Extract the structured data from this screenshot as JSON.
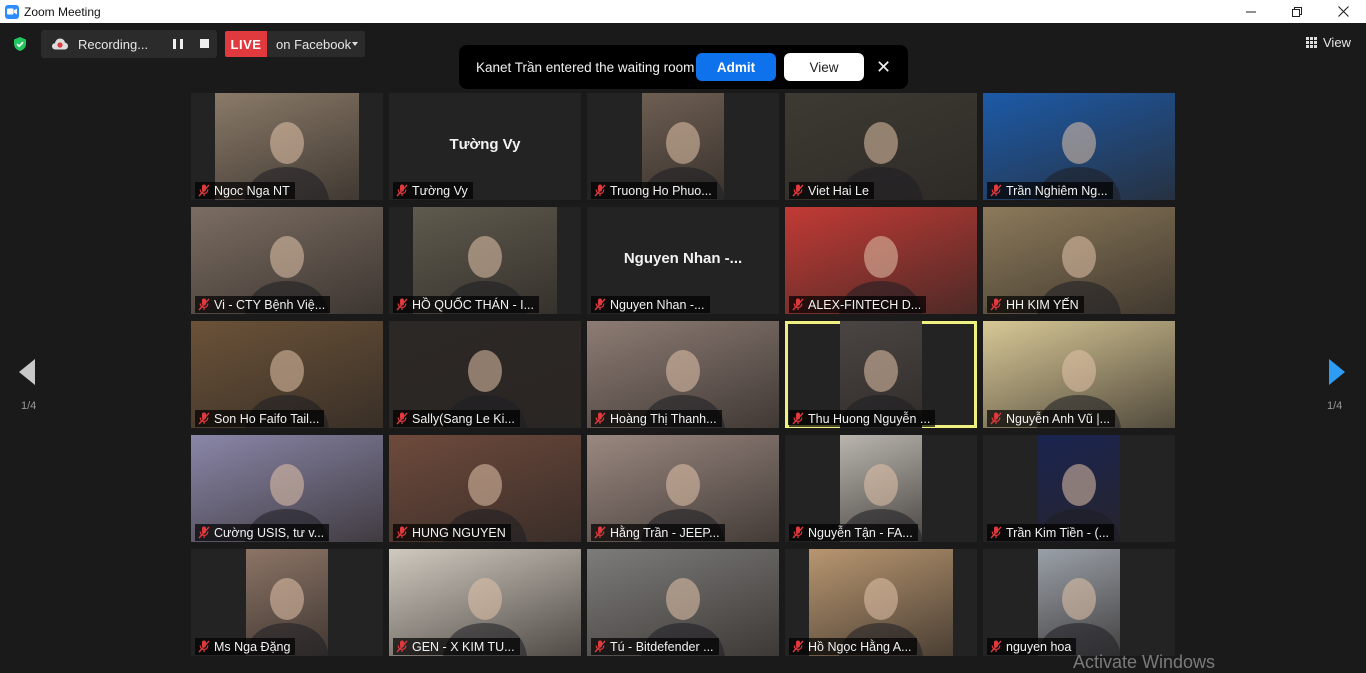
{
  "window": {
    "title": "Zoom Meeting"
  },
  "toolbar": {
    "recording_label": "Recording...",
    "live_label": "LIVE",
    "live_destination": "on Facebook",
    "view_label": "View"
  },
  "notification": {
    "message": "Kanet Trần entered the waiting room",
    "admit_label": "Admit",
    "view_label": "View",
    "close_glyph": "✕"
  },
  "pagination": {
    "left": "1/4",
    "right": "1/4"
  },
  "tiles": [
    {
      "name": "Ngoc Nga NT",
      "video": true,
      "color": "#8a7a68"
    },
    {
      "name": "Tường Vy",
      "video": false,
      "center_name": "Tường Vy"
    },
    {
      "name": "Truong Ho Phuo...",
      "video": true,
      "color": "#6d5e52"
    },
    {
      "name": "Viet Hai Le",
      "video": true,
      "color": "#3d3a33"
    },
    {
      "name": "Trần Nghiêm Ng...",
      "video": true,
      "color": "#1c5aa8"
    },
    {
      "name": "Vi - CTY Bệnh Việ...",
      "video": true,
      "color": "#7b6d62"
    },
    {
      "name": "HỒ QUỐC THÁN - I...",
      "video": true,
      "color": "#5e5a4d"
    },
    {
      "name": "Nguyen Nhan -...",
      "video": false,
      "center_name": "Nguyen Nhan -..."
    },
    {
      "name": "ALEX-FINTECH D...",
      "video": true,
      "color": "#c23a35"
    },
    {
      "name": "HH KIM YẾN",
      "video": true,
      "color": "#8c7a5a"
    },
    {
      "name": "Son Ho Faifo Tail...",
      "video": true,
      "color": "#6b5238"
    },
    {
      "name": "Sally(Sang Le Ki...",
      "video": true,
      "color": "#2c2826"
    },
    {
      "name": "Hoàng Thị Thanh...",
      "video": true,
      "color": "#8d7c74"
    },
    {
      "name": "Thu Huong Nguyễn ...",
      "video": true,
      "color": "#4a4542",
      "active": true
    },
    {
      "name": "Nguyễn Anh Vũ |...",
      "video": true,
      "color": "#d8c896"
    },
    {
      "name": "Cường USIS, tư v...",
      "video": true,
      "color": "#8a86a8"
    },
    {
      "name": "HUNG NGUYEN",
      "video": true,
      "color": "#6e4a3c"
    },
    {
      "name": "Hằng Trần - JEEP...",
      "video": true,
      "color": "#9a8880"
    },
    {
      "name": "Nguyễn Tận - FA...",
      "video": true,
      "color": "#b9b5ae"
    },
    {
      "name": "Trần Kim Tiền - (...",
      "video": true,
      "color": "#1a2450"
    },
    {
      "name": "Ms Nga Đặng",
      "video": true,
      "color": "#8c7466"
    },
    {
      "name": "GEN - X KIM TU...",
      "video": true,
      "color": "#cfc9bf"
    },
    {
      "name": "Tú - Bitdefender ...",
      "video": true,
      "color": "#7d7c7a"
    },
    {
      "name": "Hồ Ngọc Hằng A...",
      "video": true,
      "color": "#b89670"
    },
    {
      "name": "nguyen hoa",
      "video": true,
      "color": "#9aa0a8"
    }
  ],
  "overlay": {
    "activate_windows": "Activate Windows"
  }
}
